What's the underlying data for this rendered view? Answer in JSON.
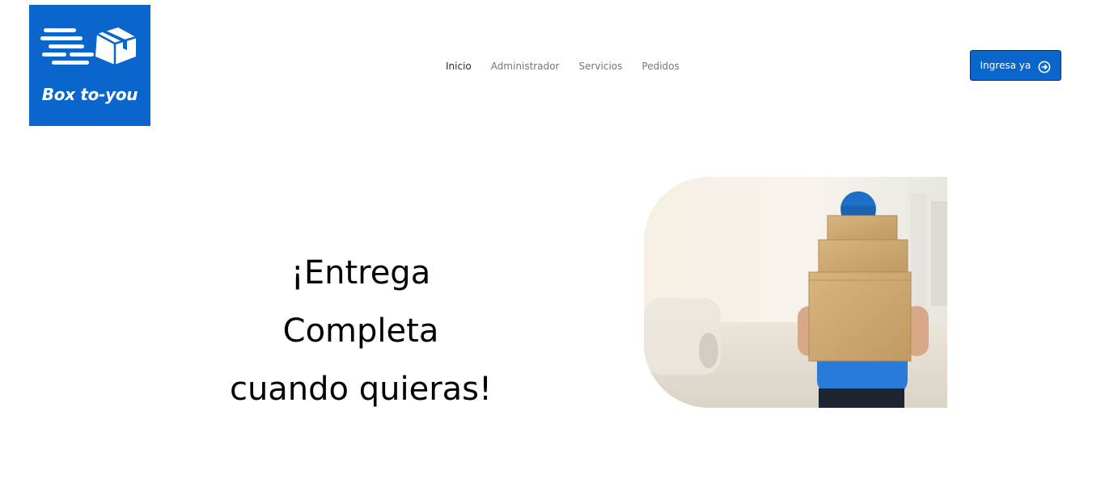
{
  "brand": {
    "logo_text": "Box to-you",
    "logo_color": "#0a66cc",
    "logo_icon": "fast-delivery-box-icon"
  },
  "nav": {
    "items": [
      {
        "label": "Inicio",
        "active": true
      },
      {
        "label": "Administrador",
        "active": false
      },
      {
        "label": "Servicios",
        "active": false
      },
      {
        "label": "Pedidos",
        "active": false
      }
    ]
  },
  "cta": {
    "label": "Ingresa ya",
    "icon": "arrow-circle-right-icon",
    "color": "#0a66cc"
  },
  "hero": {
    "lines": [
      "¡Entrega",
      "Completa",
      "cuando quieras!"
    ],
    "image_alt": "delivery-person-carrying-boxes"
  }
}
